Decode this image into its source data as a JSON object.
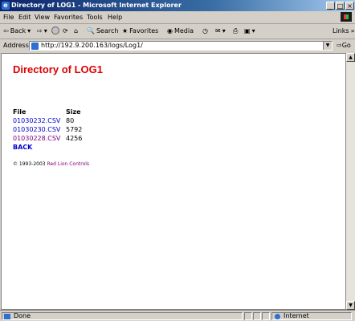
{
  "window": {
    "title": "Directory of LOG1 - Microsoft Internet Explorer",
    "minimize": "_",
    "maximize": "□",
    "close": "×"
  },
  "menu": [
    "File",
    "Edit",
    "View",
    "Favorites",
    "Tools",
    "Help"
  ],
  "toolbar": {
    "back": "Back",
    "search": "Search",
    "favorites": "Favorites",
    "media": "Media",
    "links": "Links"
  },
  "address": {
    "label": "Address",
    "url": "http://192.9.200.163/logs/Log1/",
    "go": "Go"
  },
  "page": {
    "title": "Directory of LOG1",
    "headers": {
      "file": "File",
      "size": "Size"
    },
    "files": [
      {
        "name": "01030232.CSV",
        "size": "80"
      },
      {
        "name": "01030230.CSV",
        "size": "5792"
      },
      {
        "name": "01030228.CSV",
        "size": "4256"
      }
    ],
    "back_link": "BACK",
    "copyright_prefix": "© 1993-2003",
    "copyright_company": "Red Lion Controls"
  },
  "status": {
    "text": "Done",
    "zone": "Internet"
  },
  "colors": {
    "title_red": "#e00000",
    "link_blue": "#0000cc",
    "visited_purple": "#800080"
  }
}
